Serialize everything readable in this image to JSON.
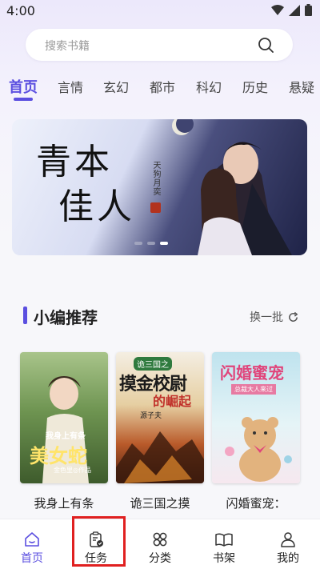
{
  "status": {
    "time": "4:00"
  },
  "search": {
    "placeholder": "搜索书籍"
  },
  "tabs": [
    {
      "label": "首页",
      "active": true
    },
    {
      "label": "言情"
    },
    {
      "label": "玄幻"
    },
    {
      "label": "都市"
    },
    {
      "label": "科幻"
    },
    {
      "label": "历史"
    },
    {
      "label": "悬疑"
    }
  ],
  "banner": {
    "title_line1": "青本",
    "title_line2": "佳人",
    "author": "天狗月奕",
    "seal_char": "著"
  },
  "section": {
    "title": "小编推荐",
    "refresh_label": "换一批"
  },
  "books": [
    {
      "name": "我身上有条",
      "cover_text": "我身上有条",
      "cover_title": "美女蛇",
      "cover_author": "金色里◎作品",
      "color": "#7da25a"
    },
    {
      "name": "诡三国之摸",
      "cover_text": "诡三国之",
      "cover_title": "摸金校尉",
      "cover_subtitle": "的崛起",
      "cover_author": "源子夫",
      "color": "#c8442a"
    },
    {
      "name": "闪婚蜜宠：",
      "cover_text": "闪婚蜜宠",
      "cover_subtitle": "总裁大人来过",
      "color": "#8bc8d8"
    }
  ],
  "nav": [
    {
      "label": "首页",
      "icon": "home-icon",
      "active": true
    },
    {
      "label": "任务",
      "icon": "task-icon"
    },
    {
      "label": "分类",
      "icon": "category-icon"
    },
    {
      "label": "书架",
      "icon": "bookshelf-icon"
    },
    {
      "label": "我的",
      "icon": "profile-icon"
    }
  ],
  "colors": {
    "accent": "#5b4fe0",
    "highlight": "#e02020"
  }
}
